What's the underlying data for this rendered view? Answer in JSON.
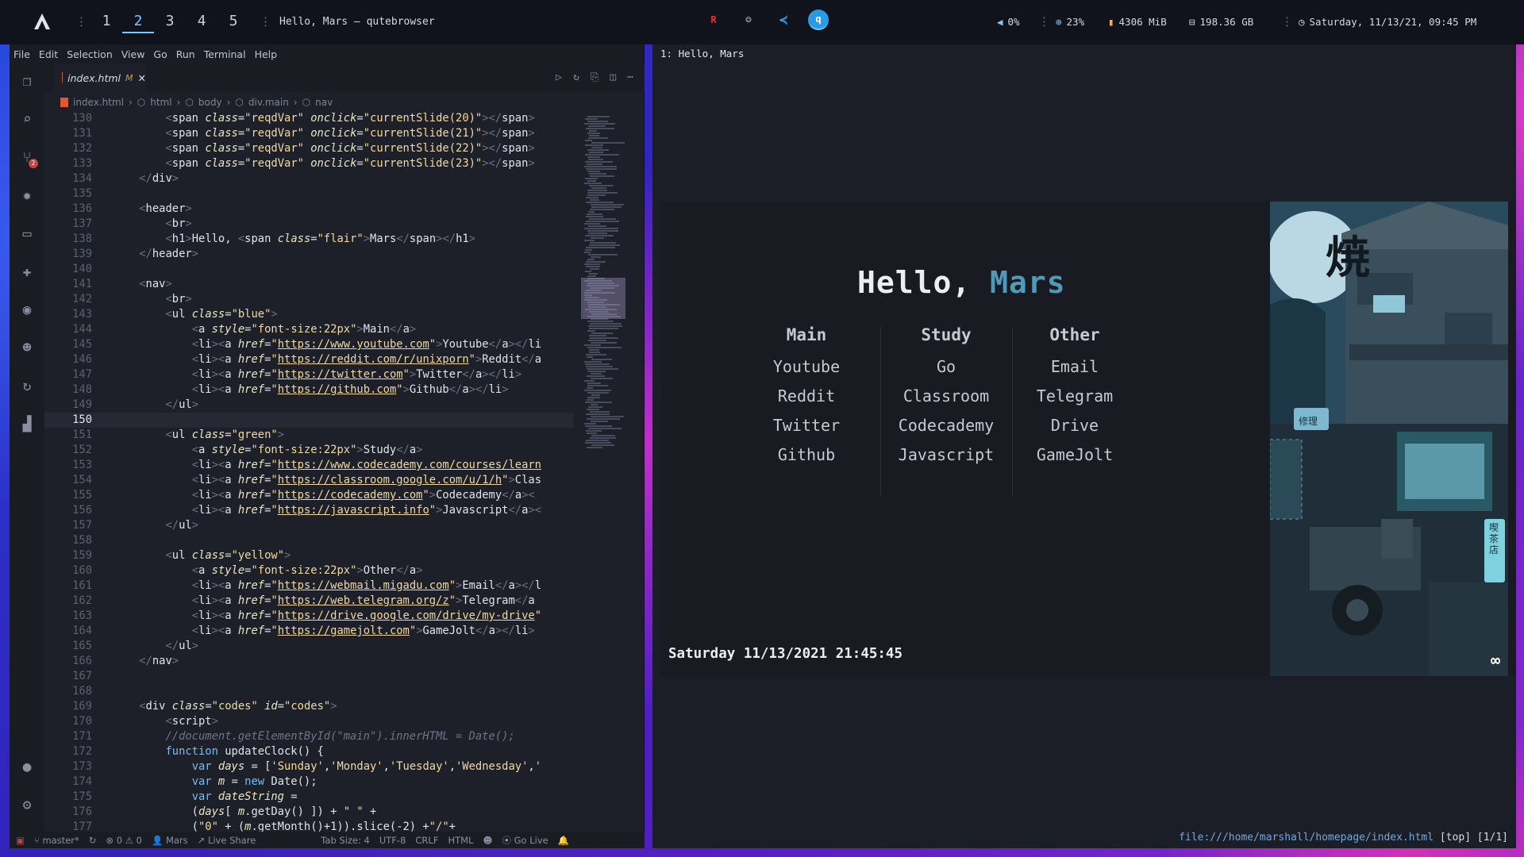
{
  "topbar": {
    "workspaces": [
      "1",
      "2",
      "3",
      "4",
      "5"
    ],
    "active_workspace": "2",
    "window_title": "Hello, Mars — qutebrowser",
    "tray_icons": [
      "redmi-icon",
      "discord-icon",
      "vscode-icon",
      "qutebrowser-icon"
    ],
    "volume": "0%",
    "cpu": "23%",
    "memory": "4306 MiB",
    "disk": "198.36 GB",
    "datetime": "Saturday, 11/13/21, 09:45 PM"
  },
  "editor": {
    "menu": [
      "File",
      "Edit",
      "Selection",
      "View",
      "Go",
      "Run",
      "Terminal",
      "Help"
    ],
    "tab_name": "index.html",
    "tab_modified": "M",
    "breadcrumbs": [
      "index.html",
      "html",
      "body",
      "div.main",
      "nav"
    ],
    "current_line": 150,
    "scm_badge": "2",
    "status": {
      "branch": "master*",
      "errors": "0",
      "warnings": "0",
      "user": "Mars",
      "live_share": "Live Share",
      "tab_size": "Tab Size: 4",
      "encoding": "UTF-8",
      "eol": "CRLF",
      "language": "HTML",
      "go_live": "Go Live"
    }
  },
  "browser": {
    "tab_label": "1: Hello, Mars",
    "heading_prefix": "Hello, ",
    "heading_name": "Mars",
    "nav": [
      {
        "title": "Main",
        "links": [
          "Youtube",
          "Reddit",
          "Twitter",
          "Github"
        ]
      },
      {
        "title": "Study",
        "links": [
          "Go",
          "Classroom",
          "Codecademy",
          "Javascript"
        ]
      },
      {
        "title": "Other",
        "links": [
          "Email",
          "Telegram",
          "Drive",
          "GameJolt"
        ]
      }
    ],
    "clock": "Saturday 11/13/2021 21:45:45",
    "url": "file:///home/marshall/homepage/index.html",
    "scroll_status": "[top] [1/1]",
    "art_signs": [
      "修理",
      "喫茶店"
    ]
  },
  "colors": {
    "accent": "#7cc6ff",
    "mars": "#4e9ab8",
    "bar_bg": "#11131c"
  }
}
